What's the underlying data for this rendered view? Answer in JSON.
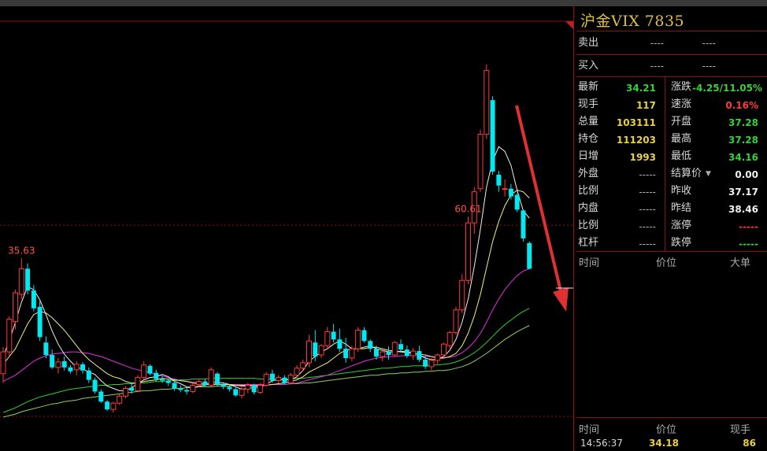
{
  "quote": {
    "title": "沪金VIX 7835",
    "sell_label": "卖出",
    "sell_price": "----",
    "sell_vol": "----",
    "buy_label": "买入",
    "buy_price": "----",
    "buy_vol": "----",
    "left": [
      {
        "label": "最新",
        "value": "34.21",
        "color": "green"
      },
      {
        "label": "现手",
        "value": "117",
        "color": "yellow"
      },
      {
        "label": "总量",
        "value": "103111",
        "color": "yellow"
      },
      {
        "label": "持仓",
        "value": "111203",
        "color": "yellow"
      },
      {
        "label": "日增",
        "value": "1993",
        "color": "yellow"
      },
      {
        "label": "外盘",
        "value": "-----",
        "color": "dash"
      },
      {
        "label": "比例",
        "value": "-----",
        "color": "dash"
      },
      {
        "label": "内盘",
        "value": "-----",
        "color": "dash"
      },
      {
        "label": "比例",
        "value": "-----",
        "color": "dash"
      },
      {
        "label": "杠杆",
        "value": "-----",
        "color": "dash"
      }
    ],
    "right": [
      {
        "label": "涨跌",
        "value": "-4.25/11.05%",
        "color": "green"
      },
      {
        "label": "速涨",
        "value": "0.16%",
        "color": "red"
      },
      {
        "label": "开盘",
        "value": "37.28",
        "color": "green"
      },
      {
        "label": "最高",
        "value": "37.28",
        "color": "green"
      },
      {
        "label": "最低",
        "value": "34.16",
        "color": "green"
      },
      {
        "label": "结算价",
        "value": "0.00",
        "color": "white"
      },
      {
        "label": "昨收",
        "value": "37.17",
        "color": "white"
      },
      {
        "label": "昨结",
        "value": "38.46",
        "color": "white"
      },
      {
        "label": "涨停",
        "value": "-----",
        "color": "red"
      },
      {
        "label": "跌停",
        "value": "-----",
        "color": "green"
      }
    ],
    "ticks_header": {
      "time": "时间",
      "price": "价位",
      "size": "大单"
    },
    "trades_header": {
      "time": "时间",
      "price": "价位",
      "size": "现手"
    },
    "last_trade": {
      "time": "14:56:37",
      "price": "34.18",
      "size": "86"
    }
  },
  "chart_data": {
    "type": "candlestick",
    "colors": {
      "up": "#ff3a3a",
      "down": "#00e8f0",
      "ma5": "#f0f0f0",
      "ma10": "#f0f080",
      "ma20": "#e030e0",
      "ma40": "#30d030",
      "ma60": "#90d060",
      "arrow": "#e03030"
    },
    "annotations": {
      "high_label": "60.61",
      "high_index": 76,
      "local_label": "35.63",
      "local_index": 3
    },
    "ylim": [
      15.2,
      62.6
    ],
    "reference_price": 39.9,
    "candles": [
      [
        20.8,
        24.2,
        19.6,
        23.6
      ],
      [
        23.6,
        28.2,
        23.0,
        27.8
      ],
      [
        27.5,
        31.6,
        26.5,
        31.2
      ],
      [
        31.0,
        35.63,
        30.4,
        34.3
      ],
      [
        34.3,
        35.0,
        31.0,
        31.5
      ],
      [
        31.5,
        32.2,
        28.8,
        29.2
      ],
      [
        29.4,
        30.2,
        25.0,
        25.5
      ],
      [
        24.8,
        25.6,
        22.8,
        23.2
      ],
      [
        23.2,
        23.9,
        21.4,
        21.6
      ],
      [
        21.6,
        22.8,
        20.8,
        22.3
      ],
      [
        22.4,
        23.0,
        21.2,
        21.6
      ],
      [
        21.6,
        21.9,
        20.8,
        21.1
      ],
      [
        21.3,
        22.4,
        20.6,
        22.0
      ],
      [
        22.0,
        22.3,
        20.8,
        21.2
      ],
      [
        21.2,
        21.6,
        19.6,
        20.0
      ],
      [
        20.0,
        20.3,
        18.2,
        18.5
      ],
      [
        18.5,
        18.8,
        17.0,
        17.2
      ],
      [
        17.2,
        17.4,
        16.0,
        16.2
      ],
      [
        16.2,
        17.2,
        15.8,
        17.0
      ],
      [
        17.0,
        18.2,
        16.8,
        17.9
      ],
      [
        17.9,
        19.2,
        17.6,
        18.9
      ],
      [
        19.0,
        19.6,
        18.2,
        18.6
      ],
      [
        18.6,
        20.6,
        18.4,
        20.3
      ],
      [
        20.3,
        22.4,
        20.0,
        21.9
      ],
      [
        21.8,
        22.0,
        20.6,
        20.8
      ],
      [
        20.9,
        21.3,
        19.8,
        20.1
      ],
      [
        20.1,
        20.5,
        19.6,
        19.9
      ],
      [
        19.9,
        20.2,
        19.2,
        19.6
      ],
      [
        19.6,
        19.9,
        18.6,
        18.9
      ],
      [
        18.9,
        19.3,
        18.4,
        18.7
      ],
      [
        18.7,
        19.1,
        18.1,
        18.5
      ],
      [
        18.5,
        19.6,
        18.3,
        19.3
      ],
      [
        19.4,
        20.1,
        19.0,
        19.8
      ],
      [
        19.8,
        20.1,
        19.1,
        19.3
      ],
      [
        19.3,
        21.6,
        19.1,
        21.3
      ],
      [
        20.8,
        21.0,
        19.1,
        19.4
      ],
      [
        19.4,
        19.7,
        18.8,
        19.1
      ],
      [
        19.1,
        19.4,
        18.5,
        18.8
      ],
      [
        18.8,
        19.0,
        17.8,
        18.0
      ],
      [
        18.0,
        19.1,
        17.6,
        18.8
      ],
      [
        18.8,
        19.6,
        18.3,
        19.3
      ],
      [
        19.3,
        19.5,
        18.1,
        18.4
      ],
      [
        18.4,
        19.6,
        18.2,
        19.3
      ],
      [
        19.3,
        21.0,
        19.1,
        20.7
      ],
      [
        20.8,
        21.3,
        19.6,
        19.9
      ],
      [
        19.9,
        20.6,
        19.6,
        20.3
      ],
      [
        20.3,
        20.6,
        19.4,
        19.6
      ],
      [
        19.6,
        20.9,
        19.4,
        20.6
      ],
      [
        20.6,
        21.9,
        20.3,
        21.5
      ],
      [
        21.5,
        22.6,
        21.1,
        22.2
      ],
      [
        22.2,
        25.8,
        21.6,
        25.0
      ],
      [
        24.8,
        26.4,
        22.4,
        23.0
      ],
      [
        23.2,
        24.6,
        22.8,
        24.4
      ],
      [
        24.4,
        26.8,
        24.0,
        26.2
      ],
      [
        26.2,
        27.2,
        24.8,
        25.2
      ],
      [
        25.2,
        26.6,
        23.6,
        24.0
      ],
      [
        24.0,
        25.4,
        22.2,
        22.8
      ],
      [
        22.8,
        24.4,
        22.4,
        24.0
      ],
      [
        24.0,
        26.8,
        23.6,
        26.4
      ],
      [
        26.4,
        26.8,
        24.8,
        25.0
      ],
      [
        25.0,
        25.2,
        23.6,
        24.0
      ],
      [
        24.0,
        24.4,
        22.6,
        23.0
      ],
      [
        23.0,
        23.8,
        22.4,
        23.6
      ],
      [
        23.6,
        24.3,
        22.6,
        23.2
      ],
      [
        23.2,
        25.0,
        23.0,
        24.8
      ],
      [
        24.6,
        25.2,
        23.6,
        23.9
      ],
      [
        23.9,
        24.4,
        22.8,
        23.1
      ],
      [
        23.1,
        24.1,
        22.6,
        23.7
      ],
      [
        23.7,
        24.4,
        22.3,
        22.6
      ],
      [
        22.6,
        23.1,
        21.4,
        21.7
      ],
      [
        21.7,
        22.8,
        21.2,
        22.5
      ],
      [
        22.5,
        23.4,
        22.0,
        23.2
      ],
      [
        23.2,
        24.8,
        22.8,
        24.6
      ],
      [
        24.4,
        26.3,
        24.0,
        26.1
      ],
      [
        26.1,
        29.4,
        25.8,
        29.0
      ],
      [
        29.0,
        33.6,
        28.6,
        32.8
      ],
      [
        32.8,
        41.0,
        32.3,
        40.2
      ],
      [
        40.2,
        44.8,
        38.8,
        44.2
      ],
      [
        44.6,
        52.2,
        44.2,
        51.6
      ],
      [
        51.6,
        60.61,
        51.0,
        59.8
      ],
      [
        56.0,
        56.5,
        46.4,
        46.8
      ],
      [
        46.4,
        46.9,
        44.2,
        45.0
      ],
      [
        44.6,
        45.8,
        43.6,
        44.6
      ],
      [
        44.6,
        45.2,
        43.2,
        43.6
      ],
      [
        43.8,
        44.0,
        41.6,
        41.9
      ],
      [
        41.8,
        41.9,
        37.8,
        38.2
      ],
      [
        37.6,
        37.8,
        34.2,
        34.3
      ]
    ],
    "candle_index_note": "index order left to right",
    "ma5": [
      23.0,
      25.0,
      27.4,
      30.0,
      32.0,
      31.6,
      30.3,
      28.4,
      26.3,
      24.6,
      23.3,
      22.4,
      21.6,
      21.4,
      21.0,
      20.7,
      19.9,
      19.2,
      18.9,
      18.6,
      18.6,
      19.0,
      19.5,
      20.0,
      20.3,
      20.4,
      20.7,
      20.4,
      19.8,
      19.5,
      19.1,
      19.0,
      19.2,
      19.3,
      19.7,
      19.7,
      19.6,
      19.4,
      19.1,
      18.8,
      18.9,
      19.0,
      19.1,
      19.4,
      19.9,
      20.0,
      20.0,
      20.0,
      20.4,
      21.2,
      22.4,
      23.0,
      23.6,
      24.0,
      24.6,
      25.0,
      24.6,
      24.0,
      24.0,
      24.2,
      24.4,
      24.0,
      23.8,
      23.6,
      23.6,
      23.7,
      23.6,
      23.5,
      23.2,
      22.8,
      22.6,
      22.6,
      23.0,
      23.8,
      25.2,
      27.4,
      30.4,
      34.6,
      39.4,
      44.8,
      48.2,
      50.0,
      49.4,
      47.6,
      44.4,
      41.8,
      40.8
    ],
    "ma10": [
      22.0,
      23.0,
      24.0,
      25.6,
      27.2,
      28.4,
      28.8,
      28.6,
      28.0,
      27.2,
      26.4,
      25.4,
      24.4,
      23.4,
      22.6,
      22.0,
      21.4,
      20.8,
      20.4,
      20.2,
      19.8,
      19.6,
      19.6,
      19.8,
      19.9,
      20.0,
      20.2,
      20.1,
      20.0,
      19.9,
      19.8,
      19.6,
      19.5,
      19.4,
      19.4,
      19.4,
      19.4,
      19.4,
      19.3,
      19.2,
      19.2,
      19.2,
      19.2,
      19.3,
      19.4,
      19.5,
      19.6,
      19.8,
      20.0,
      20.4,
      21.0,
      21.4,
      21.8,
      22.2,
      22.8,
      23.4,
      23.8,
      24.0,
      24.0,
      24.0,
      24.2,
      24.2,
      24.0,
      23.8,
      23.7,
      23.6,
      23.5,
      23.4,
      23.3,
      23.2,
      23.0,
      22.8,
      22.8,
      23.0,
      23.4,
      24.4,
      26.0,
      28.2,
      31.0,
      34.4,
      37.8,
      40.4,
      42.4,
      43.8,
      44.4,
      44.2,
      43.4
    ],
    "ma20": [
      19.8,
      20.2,
      20.6,
      21.2,
      21.8,
      22.4,
      22.8,
      23.1,
      23.3,
      23.4,
      23.5,
      23.6,
      23.6,
      23.5,
      23.4,
      23.2,
      23.0,
      22.7,
      22.4,
      22.1,
      21.8,
      21.5,
      21.3,
      21.1,
      20.9,
      20.7,
      20.5,
      20.3,
      20.1,
      19.9,
      19.8,
      19.7,
      19.6,
      19.5,
      19.5,
      19.5,
      19.4,
      19.4,
      19.4,
      19.4,
      19.4,
      19.4,
      19.4,
      19.4,
      19.4,
      19.4,
      19.4,
      19.5,
      19.6,
      19.8,
      20.0,
      20.2,
      20.4,
      20.6,
      20.9,
      21.2,
      21.5,
      21.8,
      22.1,
      22.4,
      22.6,
      22.8,
      22.9,
      23.0,
      23.0,
      23.1,
      23.1,
      23.1,
      23.1,
      23.0,
      23.0,
      22.9,
      22.9,
      22.9,
      23.1,
      23.5,
      24.1,
      24.9,
      26.0,
      27.4,
      29.0,
      30.4,
      31.6,
      32.6,
      33.4,
      34.0,
      34.3
    ],
    "ma40": [
      15.8,
      16.1,
      16.4,
      16.8,
      17.2,
      17.5,
      17.8,
      18.0,
      18.2,
      18.4,
      18.6,
      18.8,
      18.9,
      19.0,
      19.1,
      19.2,
      19.3,
      19.3,
      19.4,
      19.4,
      19.5,
      19.5,
      19.6,
      19.6,
      19.7,
      19.8,
      19.8,
      19.9,
      19.9,
      20.0,
      20.0,
      20.1,
      20.1,
      20.1,
      20.2,
      20.2,
      20.2,
      20.2,
      20.2,
      20.2,
      20.2,
      20.2,
      20.1,
      20.1,
      20.1,
      20.1,
      20.1,
      20.1,
      20.2,
      20.2,
      20.3,
      20.4,
      20.5,
      20.6,
      20.7,
      20.8,
      20.9,
      21.0,
      21.1,
      21.2,
      21.3,
      21.4,
      21.5,
      21.5,
      21.6,
      21.7,
      21.7,
      21.8,
      21.8,
      21.8,
      21.9,
      21.9,
      22.0,
      22.1,
      22.3,
      22.6,
      23.0,
      23.5,
      24.1,
      24.8,
      25.6,
      26.4,
      27.1,
      27.7,
      28.3,
      28.8,
      29.2
    ],
    "ma60": [
      15.2,
      15.4,
      15.6,
      15.9,
      16.1,
      16.3,
      16.5,
      16.7,
      16.9,
      17.0,
      17.2,
      17.3,
      17.4,
      17.6,
      17.7,
      17.8,
      17.9,
      18.0,
      18.1,
      18.2,
      18.3,
      18.4,
      18.5,
      18.6,
      18.6,
      18.7,
      18.8,
      18.8,
      18.9,
      18.9,
      19.0,
      19.0,
      19.1,
      19.1,
      19.1,
      19.2,
      19.2,
      19.2,
      19.3,
      19.3,
      19.3,
      19.3,
      19.3,
      19.4,
      19.4,
      19.4,
      19.4,
      19.5,
      19.5,
      19.6,
      19.6,
      19.7,
      19.8,
      19.9,
      20.0,
      20.1,
      20.2,
      20.3,
      20.4,
      20.5,
      20.6,
      20.6,
      20.7,
      20.8,
      20.8,
      20.9,
      20.9,
      21.0,
      21.0,
      21.1,
      21.1,
      21.2,
      21.2,
      21.3,
      21.5,
      21.7,
      22.0,
      22.4,
      22.9,
      23.4,
      24.0,
      24.6,
      25.2,
      25.7,
      26.2,
      26.6,
      27.0
    ]
  }
}
